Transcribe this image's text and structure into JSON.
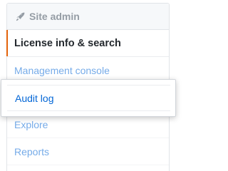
{
  "menu": {
    "header": {
      "icon": "rocket-icon",
      "label": "Site admin"
    },
    "items": [
      {
        "label": "License info & search",
        "selected": true
      },
      {
        "label": "Management console",
        "selected": false
      },
      {
        "label": "Audit log",
        "selected": false,
        "highlighted": true
      },
      {
        "label": "Explore",
        "selected": false
      },
      {
        "label": "Reports",
        "selected": false
      }
    ]
  },
  "colors": {
    "link": "#0366d6",
    "selected_indicator": "#e36209",
    "header_text": "#959da5",
    "selected_text": "#24292e"
  }
}
